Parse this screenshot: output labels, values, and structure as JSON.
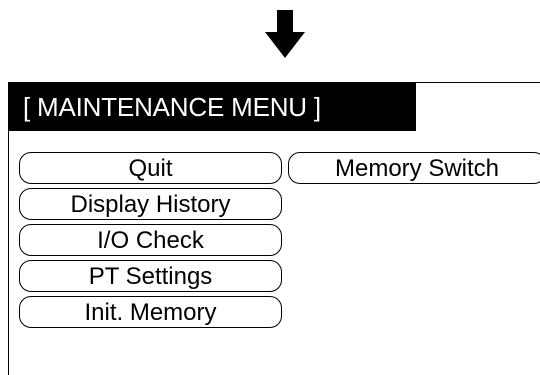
{
  "icons": {
    "flow_arrow": "down-arrow-icon"
  },
  "menu": {
    "title": "[ MAINTENANCE MENU ]",
    "buttons": {
      "quit": "Quit",
      "memory_switch": "Memory Switch",
      "display_history": "Display History",
      "io_check": "I/O Check",
      "pt_settings": "PT Settings",
      "init_memory": "Init. Memory"
    }
  },
  "colors": {
    "title_background": "#000000",
    "title_text": "#ffffff",
    "button_border": "#000000"
  }
}
